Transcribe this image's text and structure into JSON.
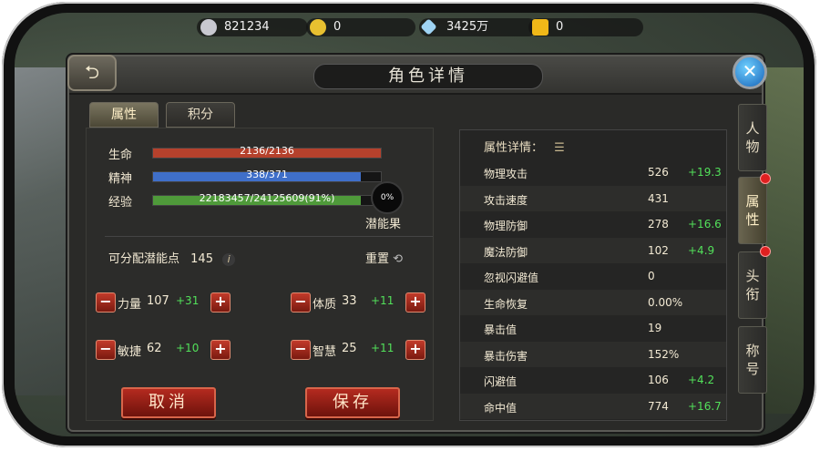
{
  "resources": [
    {
      "icon": "silver-coin-icon",
      "value": "821234"
    },
    {
      "icon": "gold-coin-icon",
      "value": "0"
    },
    {
      "icon": "diamond-icon",
      "value": "3425万"
    },
    {
      "icon": "gold-ingot-icon",
      "value": "0"
    }
  ],
  "title": "角色详情",
  "tabs": [
    "属性",
    "积分"
  ],
  "bars": [
    {
      "label": "生命",
      "text": "2136/2136",
      "fraction": 1.0,
      "color": "#b5412c"
    },
    {
      "label": "精神",
      "text": "338/371",
      "fraction": 0.911,
      "color": "#3f6fc9"
    },
    {
      "label": "经验",
      "text": "22183457/24125609(91%)",
      "fraction": 0.91,
      "color": "#4f9a3a"
    }
  ],
  "fruit": {
    "percent": "0%",
    "label": "潜能果"
  },
  "points": {
    "label": "可分配潜能点",
    "value": "145"
  },
  "reset_label": "重置",
  "stats": [
    {
      "name": "力量",
      "value": "107",
      "bonus": "+31"
    },
    {
      "name": "体质",
      "value": "33",
      "bonus": "+11"
    },
    {
      "name": "敏捷",
      "value": "62",
      "bonus": "+10"
    },
    {
      "name": "智慧",
      "value": "25",
      "bonus": "+11"
    }
  ],
  "buttons": {
    "cancel": "取消",
    "save": "保存"
  },
  "detail_title": "属性详情：",
  "details": [
    {
      "name": "物理攻击",
      "value": "526",
      "bonus": "+19.3"
    },
    {
      "name": "攻击速度",
      "value": "431",
      "bonus": ""
    },
    {
      "name": "物理防御",
      "value": "278",
      "bonus": "+16.6"
    },
    {
      "name": "魔法防御",
      "value": "102",
      "bonus": "+4.9"
    },
    {
      "name": "忽视闪避值",
      "value": "0",
      "bonus": ""
    },
    {
      "name": "生命恢复",
      "value": "0.00%",
      "bonus": ""
    },
    {
      "name": "暴击值",
      "value": "19",
      "bonus": ""
    },
    {
      "name": "暴击伤害",
      "value": "152%",
      "bonus": ""
    },
    {
      "name": "闪避值",
      "value": "106",
      "bonus": "+4.2"
    },
    {
      "name": "命中值",
      "value": "774",
      "bonus": "+16.7"
    }
  ],
  "side_tabs": [
    "人物",
    "属性",
    "头衔",
    "称号"
  ]
}
